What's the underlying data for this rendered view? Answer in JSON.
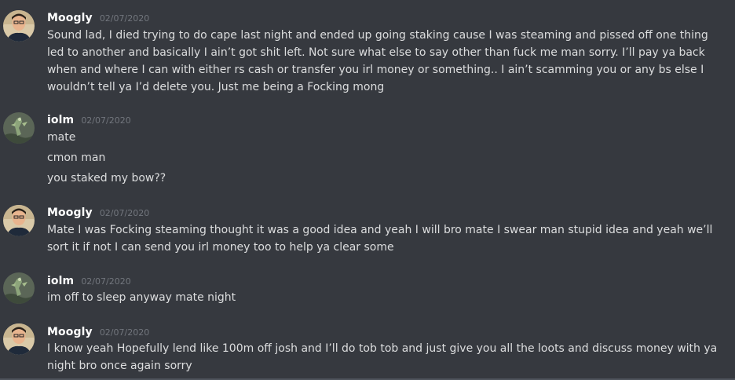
{
  "colors": {
    "background": "#36393f",
    "username": "#ffffff",
    "timestamp": "#72767d",
    "text": "#dcddde"
  },
  "messages": [
    {
      "author": "Moogly",
      "avatar_icon": "avatar-moogly-icon",
      "timestamp": "02/07/2020",
      "lines": [
        "Sound lad, I died trying to do cape last night and ended up going staking cause I was steaming and pissed off one thing led to another and basically I ain’t got shit left. Not sure what else to say other than fuck me man sorry. I’ll pay ya back when and where I can with either rs cash or transfer you irl money or something.. I ain’t scamming you or any bs else I wouldn’t tell ya I’d delete you. Just me being a Focking mong"
      ]
    },
    {
      "author": "iolm",
      "avatar_icon": "avatar-iolm-icon",
      "timestamp": "02/07/2020",
      "lines": [
        "mate",
        "cmon man",
        "you staked my bow??"
      ]
    },
    {
      "author": "Moogly",
      "avatar_icon": "avatar-moogly-icon",
      "timestamp": "02/07/2020",
      "lines": [
        "Mate I was Focking steaming thought it was a good idea and yeah I will bro mate I swear man stupid idea and yeah we’ll sort it if not I can send you irl money too to help ya clear some"
      ]
    },
    {
      "author": "iolm",
      "avatar_icon": "avatar-iolm-icon",
      "timestamp": "02/07/2020",
      "lines": [
        "im off to sleep anyway mate night"
      ]
    },
    {
      "author": "Moogly",
      "avatar_icon": "avatar-moogly-icon",
      "timestamp": "02/07/2020",
      "lines": [
        "I know yeah Hopefully lend like 100m off josh and I’ll do tob tob and just give you all the loots and discuss money with ya night bro once again sorry"
      ]
    }
  ]
}
